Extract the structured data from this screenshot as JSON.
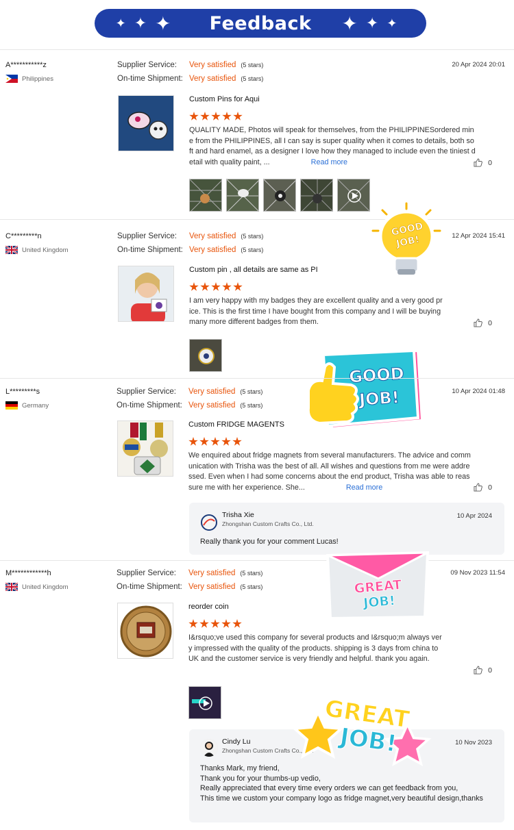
{
  "header": {
    "title": "Feedback",
    "sparkle": "✦"
  },
  "labels": {
    "supplier_service": "Supplier Service:",
    "ontime_shipment": "On-time Shipment:",
    "read_more": "Read more"
  },
  "colors": {
    "accent": "#e8540b",
    "banner": "#1f3fa7",
    "link": "#2a6fd6"
  },
  "reviews": [
    {
      "buyer": "A***********z",
      "country": "Philippines",
      "supplier_value": "Very satisfied",
      "supplier_stars": "(5 stars)",
      "shipment_value": "Very satisfied",
      "shipment_stars": "(5 stars)",
      "date": "20 Apr 2024 20:01",
      "product": "Custom Pins for Aqui",
      "rating": 5,
      "text": "QUALITY MADE, Photos will speak for themselves, from the PHILIPPINESordered mine from the PHILIPPINES, all I can say is super quality when it comes to details, both soft and hard enamel, as a designer I love how they managed to include even the tiniest detail with quality paint, ...",
      "read_more": true,
      "likes": "0"
    },
    {
      "buyer": "C*********n",
      "country": "United Kingdom",
      "supplier_value": "Very satisfied",
      "supplier_stars": "(5 stars)",
      "shipment_value": "Very satisfied",
      "shipment_stars": "(5 stars)",
      "date": "12 Apr 2024 15:41",
      "product": "Custom pin , all details are same as PI",
      "rating": 5,
      "text": "I am very happy with my badges they are excellent quality and a very good price. This is the first time I have bought from this company and I will be buying many more different badges from them.",
      "read_more": false,
      "likes": "0"
    },
    {
      "buyer": "L*********s",
      "country": "Germany",
      "supplier_value": "Very satisfied",
      "supplier_stars": "(5 stars)",
      "shipment_value": "Very satisfied",
      "shipment_stars": "(5 stars)",
      "date": "10 Apr 2024 01:48",
      "product": "Custom FRIDGE MAGENTS",
      "rating": 5,
      "text": "We enquired about fridge magnets from several manufacturers. The advice and communication with Trisha was the best of all. All wishes and questions from me were addressed. Even when I had some concerns about the end product, Trisha was able to reassure me with her experience. She...",
      "read_more": true,
      "likes": "0",
      "reply": {
        "name": "Trisha Xie",
        "company": "Zhongshan Custom Crafts Co., Ltd.",
        "date": "10 Apr 2024",
        "text": "Really thank you for your comment Lucas!"
      }
    },
    {
      "buyer": "M************h",
      "country": "United Kingdom",
      "supplier_value": "Very satisfied",
      "supplier_stars": "(5 stars)",
      "shipment_value": "Very satisfied",
      "shipment_stars": "(5 stars)",
      "date": "09 Nov 2023 11:54",
      "product": "reorder coin",
      "rating": 5,
      "text": "I&rsquo;ve used this company for several products and I&rsquo;m always very impressed with the quality of the products. shipping is 3 days from china to UK and the customer service is very friendly and helpful. thank you again.",
      "read_more": false,
      "likes": "0",
      "reply": {
        "name": "Cindy Lu",
        "company": "Zhongshan Custom Crafts Co., Ltd.",
        "date": "10 Nov 2023",
        "text": "Thanks Mark, my friend,\nThank you for your thumbs-up vedio,\nReally appreciated that every time every orders we can get feedback from you,\nThis time we custom your company  logo as fridge magnet,very beautiful design,thanks"
      }
    }
  ],
  "stickers": {
    "s1": "GOOD JOB!",
    "s2": "GOOD JOB!",
    "s3": "GREAT JOB!",
    "s4": "GREAT JOB!"
  }
}
